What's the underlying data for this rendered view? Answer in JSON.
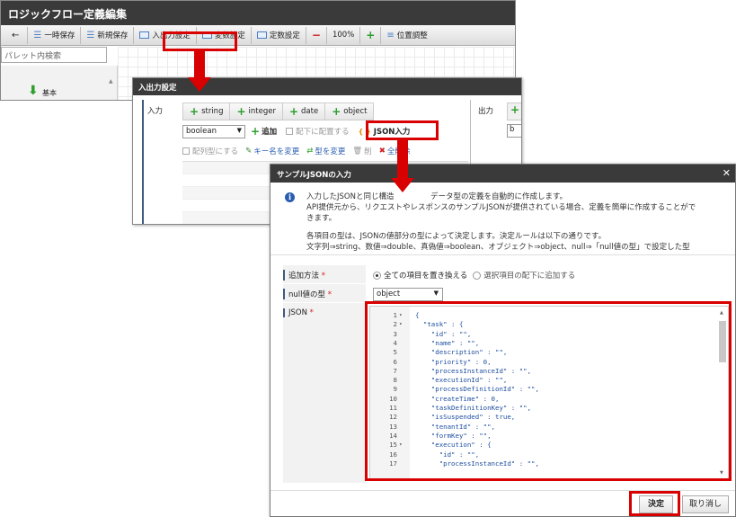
{
  "editor": {
    "title": "ロジックフロー定義編集",
    "toolbar": {
      "back_icon": "arrow-left-icon",
      "temp_save": "一時保存",
      "new_save": "新規保存",
      "io_settings": "入出力設定",
      "var_settings": "変数設定",
      "const_settings": "定数設定",
      "zoom": "100%",
      "position_adjust": "位置調整"
    },
    "palette": {
      "search_placeholder": "パレット内検索",
      "basic_label": "基本"
    }
  },
  "io_dialog": {
    "title": "入出力設定",
    "input_label": "入力",
    "output_label": "出力",
    "type_buttons": [
      "string",
      "integer",
      "date",
      "object"
    ],
    "type_select": "boolean",
    "add_label": "追加",
    "place_under_label": "配下に配置する",
    "json_input_label": "JSON入力",
    "array_label": "配列型にする",
    "rename_key_label": "キー名を変更",
    "change_type_label": "型を変更",
    "delete_label": "削",
    "delete_all_label": "全削除",
    "output_select": "b"
  },
  "json_dialog": {
    "title": "サンプルJSONの入力",
    "info_lines": [
      "入力したJSONと同じ構造",
      "データ型の定義を自動的に作成します。",
      "API提供元から、リクエストやレスポンスのサンプルJSONが提供されている場合、定義を簡単に作成することがで",
      "きます。",
      "各項目の型は、JSONの値部分の型によって決定します。決定ルールは以下の通りです。",
      "文字列⇒string、数値⇒double、真偽値⇒boolean、オブジェクト⇒object、null⇒「null値の型」で設定した型"
    ],
    "add_method_label": "追加方法",
    "add_method_options": [
      "全ての項目を置き換える",
      "選択項目の配下に追加する"
    ],
    "null_type_label": "null値の型",
    "null_type_value": "object",
    "json_label": "JSON",
    "required_mark": "*",
    "code_lines": [
      {
        "n": "1",
        "fold": "▾",
        "text": "{"
      },
      {
        "n": "2",
        "fold": "▾",
        "text": "  \"task\" : {"
      },
      {
        "n": "3",
        "fold": "",
        "text": "    \"id\" : \"\","
      },
      {
        "n": "4",
        "fold": "",
        "text": "    \"name\" : \"\","
      },
      {
        "n": "5",
        "fold": "",
        "text": "    \"description\" : \"\","
      },
      {
        "n": "6",
        "fold": "",
        "text": "    \"priority\" : 0,"
      },
      {
        "n": "7",
        "fold": "",
        "text": "    \"processInstanceId\" : \"\","
      },
      {
        "n": "8",
        "fold": "",
        "text": "    \"executionId\" : \"\","
      },
      {
        "n": "9",
        "fold": "",
        "text": "    \"processDefinitionId\" : \"\","
      },
      {
        "n": "10",
        "fold": "",
        "text": "    \"createTime\" : 0,"
      },
      {
        "n": "11",
        "fold": "",
        "text": "    \"taskDefinitionKey\" : \"\","
      },
      {
        "n": "12",
        "fold": "",
        "text": "    \"isSuspended\" : true,"
      },
      {
        "n": "13",
        "fold": "",
        "text": "    \"tenantId\" : \"\","
      },
      {
        "n": "14",
        "fold": "",
        "text": "    \"formKey\" : \"\","
      },
      {
        "n": "15",
        "fold": "▾",
        "text": "    \"execution\" : {"
      },
      {
        "n": "16",
        "fold": "",
        "text": "      \"id\" : \"\","
      },
      {
        "n": "17",
        "fold": "",
        "text": "      \"processInstanceId\" : \"\","
      }
    ],
    "ok_label": "決定",
    "cancel_label": "取り消し",
    "close_icon": "close-icon"
  },
  "colors": {
    "titlebar": "#3a3a3a",
    "highlight": "#d80000",
    "add_green": "#2e9e2e"
  }
}
